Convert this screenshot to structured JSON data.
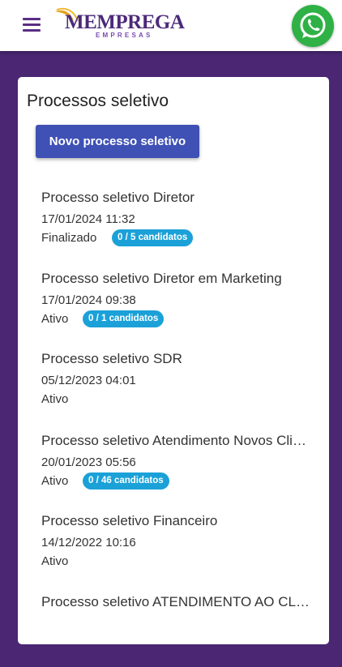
{
  "header": {
    "logo_text": "MEMPREGA",
    "logo_subtext": "EMPRESAS",
    "menu_icon": "hamburger-menu-icon",
    "whatsapp_icon": "whatsapp-icon"
  },
  "colors": {
    "background": "#4a2673",
    "primary_button": "#3f51b5",
    "badge": "#1ba1d8",
    "whatsapp": "#2fb146"
  },
  "page": {
    "title": "Processos seletivo",
    "new_button_label": "Novo processo seletivo"
  },
  "processes": [
    {
      "name": "Processo seletivo Diretor",
      "date": "17/01/2024 11:32",
      "status": "Finalizado",
      "candidates": "0 / 5 candidatos"
    },
    {
      "name": "Processo seletivo Diretor em Marketing",
      "date": "17/01/2024 09:38",
      "status": "Ativo",
      "candidates": "0 / 1 candidatos"
    },
    {
      "name": "Processo seletivo SDR",
      "date": "05/12/2023 04:01",
      "status": "Ativo",
      "candidates": null
    },
    {
      "name": "Processo seletivo Atendimento Novos Clientes",
      "date": "20/01/2023 05:56",
      "status": "Ativo",
      "candidates": "0 / 46 candidatos"
    },
    {
      "name": "Processo seletivo Financeiro",
      "date": "14/12/2022 10:16",
      "status": "Ativo",
      "candidates": null
    },
    {
      "name": "Processo seletivo ATENDIMENTO AO CLIENTE",
      "date": "",
      "status": "",
      "candidates": null
    }
  ]
}
